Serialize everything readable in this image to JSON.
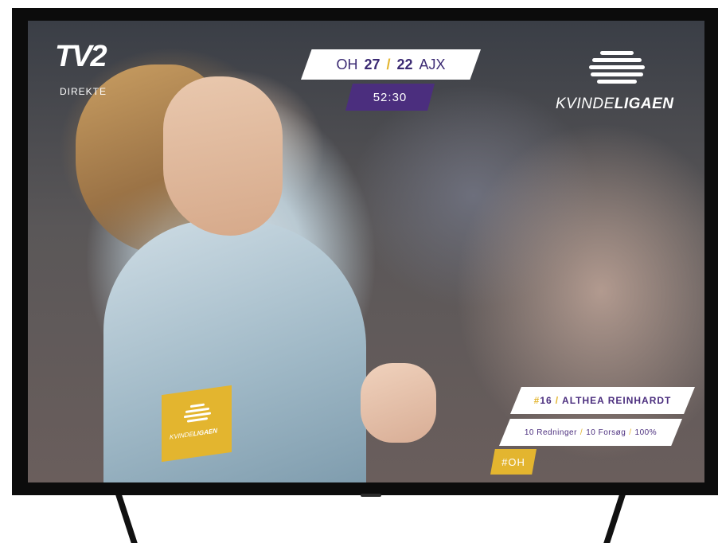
{
  "broadcaster": {
    "logo_mark": "TV2",
    "status_label": "DIREKTE"
  },
  "scoreboard": {
    "home_team": "OH",
    "home_score": "27",
    "separator": "/",
    "away_score": "22",
    "away_team": "AJX",
    "clock": "52:30"
  },
  "league": {
    "name_light": "KVINDE",
    "name_bold": "LIGAEN"
  },
  "sleeve_patch": {
    "name_light": "KVINDE",
    "name_bold": "LIGAEN"
  },
  "player": {
    "number_hash": "#",
    "number": "16",
    "name_separator": "/",
    "name": "ALTHEA REINHARDT",
    "stats": {
      "saves": "10 Redninger",
      "attempts": "10 Forsøg",
      "percentage": "100%",
      "separator": "/"
    },
    "team_tag": "#OH"
  },
  "colors": {
    "accent_purple": "#4b2e7e",
    "accent_gold": "#e3b52f",
    "overlay_white": "#ffffff",
    "tv_frame": "#0c0c0c"
  }
}
